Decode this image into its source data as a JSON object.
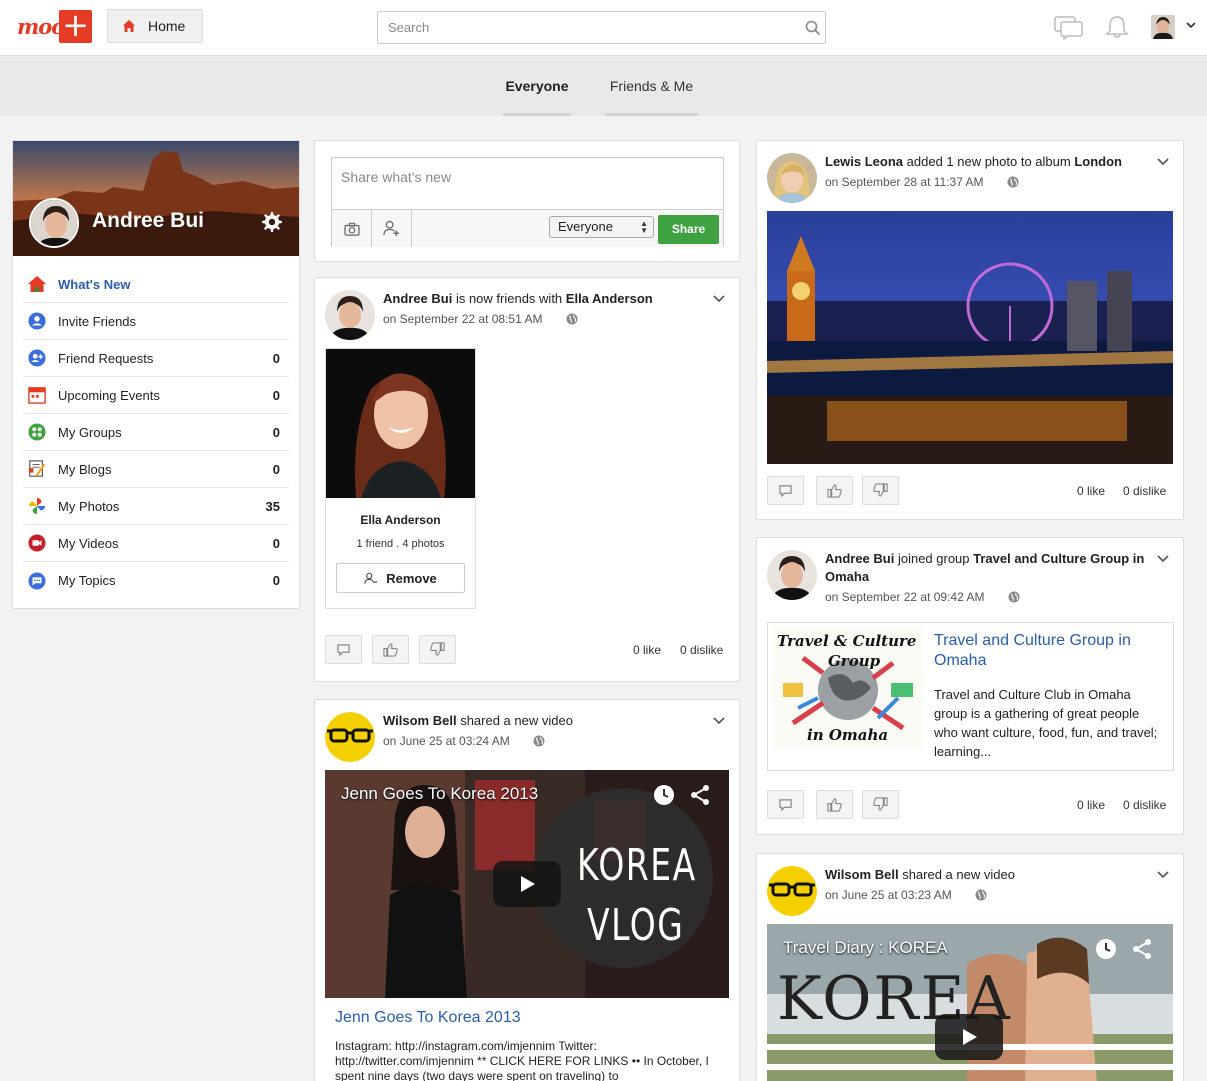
{
  "header": {
    "logo_text": "moo",
    "home_label": "Home",
    "search_placeholder": "Search"
  },
  "filters": {
    "tabs": [
      "Everyone",
      "Friends & Me"
    ],
    "active": "Everyone"
  },
  "profile": {
    "name": "Andree Bui",
    "menu": [
      {
        "label": "What's New",
        "count": "",
        "icon": "home-icon"
      },
      {
        "label": "Invite Friends",
        "count": "",
        "icon": "person-icon"
      },
      {
        "label": "Friend Requests",
        "count": "0",
        "icon": "add-person-icon"
      },
      {
        "label": "Upcoming Events",
        "count": "0",
        "icon": "calendar-icon"
      },
      {
        "label": "My Groups",
        "count": "0",
        "icon": "groups-icon"
      },
      {
        "label": "My Blogs",
        "count": "0",
        "icon": "blog-icon"
      },
      {
        "label": "My Photos",
        "count": "35",
        "icon": "photos-icon"
      },
      {
        "label": "My Videos",
        "count": "0",
        "icon": "video-icon"
      },
      {
        "label": "My Topics",
        "count": "0",
        "icon": "topics-icon"
      }
    ]
  },
  "composer": {
    "placeholder": "Share what's new",
    "privacy": "Everyone",
    "share_label": "Share"
  },
  "posts": {
    "friend": {
      "actor": "Andree Bui",
      "verb": " is now friends with ",
      "target": "Ella Anderson",
      "date": "on September 22 at 08:51 AM",
      "friend_name": "Ella Anderson",
      "friend_meta": "1 friend . 4 photos",
      "remove_label": "Remove",
      "likes": "0 like",
      "dislikes": "0 dislike"
    },
    "video1": {
      "actor": "Wilsom Bell",
      "verb": " shared a new video",
      "date": "on June 25 at 03:24 AM",
      "video_title": "Jenn Goes To Korea 2013",
      "overlay_text_1": "KOREA",
      "overlay_text_2": "VLOG",
      "link": "Jenn Goes To Korea 2013",
      "desc": "Instagram: http://instagram.com/imjennim Twitter: http://twitter.com/imjennim ** CLICK HERE FOR LINKS •• In October, I spent nine days (two days were spent on traveling) to"
    },
    "london": {
      "actor": "Lewis Leona",
      "verb": " added 1 new photo to album ",
      "target": "London",
      "date": "on September 28 at 11:37 AM",
      "likes": "0 like",
      "dislikes": "0 dislike"
    },
    "group": {
      "actor": "Andree Bui",
      "verb": " joined group ",
      "target": "Travel and Culture Group in Omaha",
      "date": "on September 22 at 09:42 AM",
      "group_title": "Travel and Culture Group in Omaha",
      "group_desc": "Travel and Culture Club in Omaha group is a gathering of great people who want culture, food, fun, and travel; learning...",
      "img_text_1": "Travel & Culture",
      "img_text_2": "Group",
      "img_text_3": "in Omaha",
      "likes": "0 like",
      "dislikes": "0 dislike"
    },
    "video2": {
      "actor": "Wilsom Bell",
      "verb": " shared a new video",
      "date": "on June 25 at 03:23 AM",
      "video_title": "Travel Diary : KOREA",
      "overlay_text": "KOREA"
    }
  },
  "colors": {
    "brand": "#e53a23",
    "link": "#2a5ea8",
    "share": "#3fa140"
  }
}
